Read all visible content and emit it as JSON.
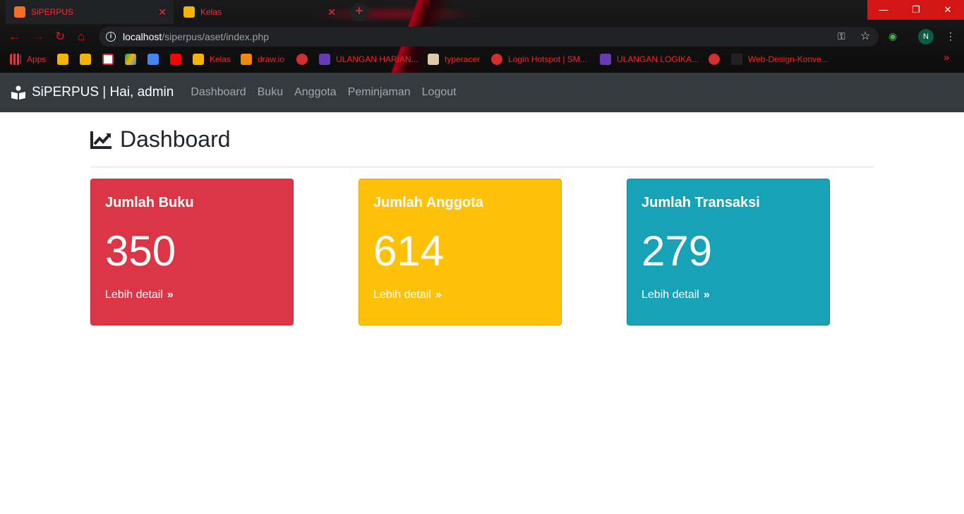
{
  "browser": {
    "tabs": [
      {
        "title": "SiPERPUS",
        "active": true
      },
      {
        "title": "Kelas",
        "active": false
      }
    ],
    "url_host": "localhost",
    "url_path": "/siperpus/aset/index.php",
    "profile_initial": "N",
    "bookmarks": [
      {
        "label": "Apps"
      },
      {
        "label": ""
      },
      {
        "label": ""
      },
      {
        "label": ""
      },
      {
        "label": ""
      },
      {
        "label": ""
      },
      {
        "label": ""
      },
      {
        "label": "Kelas"
      },
      {
        "label": "draw.io"
      },
      {
        "label": ""
      },
      {
        "label": "ULANGAN HARIAN..."
      },
      {
        "label": "typeracer"
      },
      {
        "label": "Login Hotspot | SM..."
      },
      {
        "label": "ULANGAN LOGIKA..."
      },
      {
        "label": ""
      },
      {
        "label": "Web-Design-Konve..."
      }
    ],
    "bookmarks_overflow": "»"
  },
  "app": {
    "brand": "SiPERPUS | Hai, admin",
    "nav": [
      "Dashboard",
      "Buku",
      "Anggota",
      "Peminjaman",
      "Logout"
    ],
    "page_title": "Dashboard",
    "cards": [
      {
        "title": "Jumlah Buku",
        "value": "350",
        "link": "Lebih detail",
        "color": "#dc3545"
      },
      {
        "title": "Jumlah Anggota",
        "value": "614",
        "link": "Lebih detail",
        "color": "#ffc107"
      },
      {
        "title": "Jumlah Transaksi",
        "value": "279",
        "link": "Lebih detail",
        "color": "#17a2b8"
      }
    ]
  }
}
